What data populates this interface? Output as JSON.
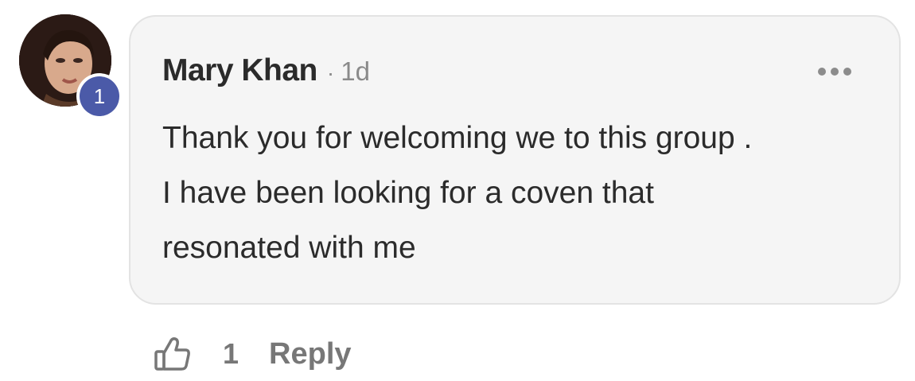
{
  "comment": {
    "author": "Mary Khan",
    "separator": "·",
    "time": "1d",
    "avatar_icon": "user-avatar-photo",
    "badge_count": "1",
    "body_lines": [
      "Thank you for welcoming we to this group .",
      "I have been looking for a coven that",
      "resonated with me"
    ],
    "more_icon": "ellipsis-icon"
  },
  "actions": {
    "like_icon": "thumbs-up-outline-icon",
    "like_count": "1",
    "reply_label": "Reply"
  },
  "colors": {
    "bubble_bg": "#f5f5f5",
    "badge_bg": "#4b5aa8",
    "text": "#2b2b2b",
    "muted": "#777777"
  }
}
